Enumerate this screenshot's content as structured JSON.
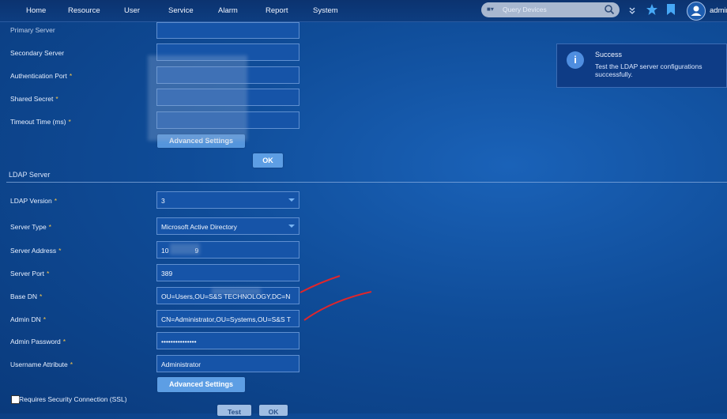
{
  "nav": {
    "items": [
      "Home",
      "Resource",
      "User",
      "Service",
      "Alarm",
      "Report",
      "System"
    ],
    "search_placeholder": "Query Devices",
    "search_scope_icon": "device-scope-icon",
    "username": "admin"
  },
  "top_form": {
    "partial_label": "Primary Server",
    "secondary_server": "Secondary Server",
    "auth_port": "Authentication Port",
    "shared_secret": "Shared Secret",
    "timeout": "Timeout Time (ms)",
    "advanced_label": "Advanced Settings",
    "ok_label": "OK"
  },
  "ldap": {
    "section_title": "LDAP Server",
    "version_label": "LDAP Version",
    "version_value": "3",
    "server_type_label": "Server Type",
    "server_type_value": "Microsoft Active Directory",
    "address_label": "Server Address",
    "address_value": "10              9",
    "port_label": "Server Port",
    "port_value": "389",
    "base_dn_label": "Base DN",
    "base_dn_value": "OU=Users,OU=S&S TECHNOLOGY,DC=N",
    "admin_dn_label": "Admin DN",
    "admin_dn_value": "CN=Administrator,OU=Systems,OU=S&S T",
    "admin_pw_label": "Admin Password",
    "admin_pw_value": "•••••••••••••••",
    "username_attr_label": "Username Attribute",
    "username_attr_value": "Administrator",
    "advanced_label": "Advanced Settings",
    "ssl_label": "Requires Security Connection (SSL)",
    "test_label": "Test",
    "ok_label": "OK",
    "required_mark": "*"
  },
  "toast": {
    "title": "Success",
    "message": "Test the LDAP server configurations successfully."
  },
  "colors": {
    "accent": "#5d9ee4",
    "required": "#f6c54a",
    "annotation": "#e0262b"
  }
}
